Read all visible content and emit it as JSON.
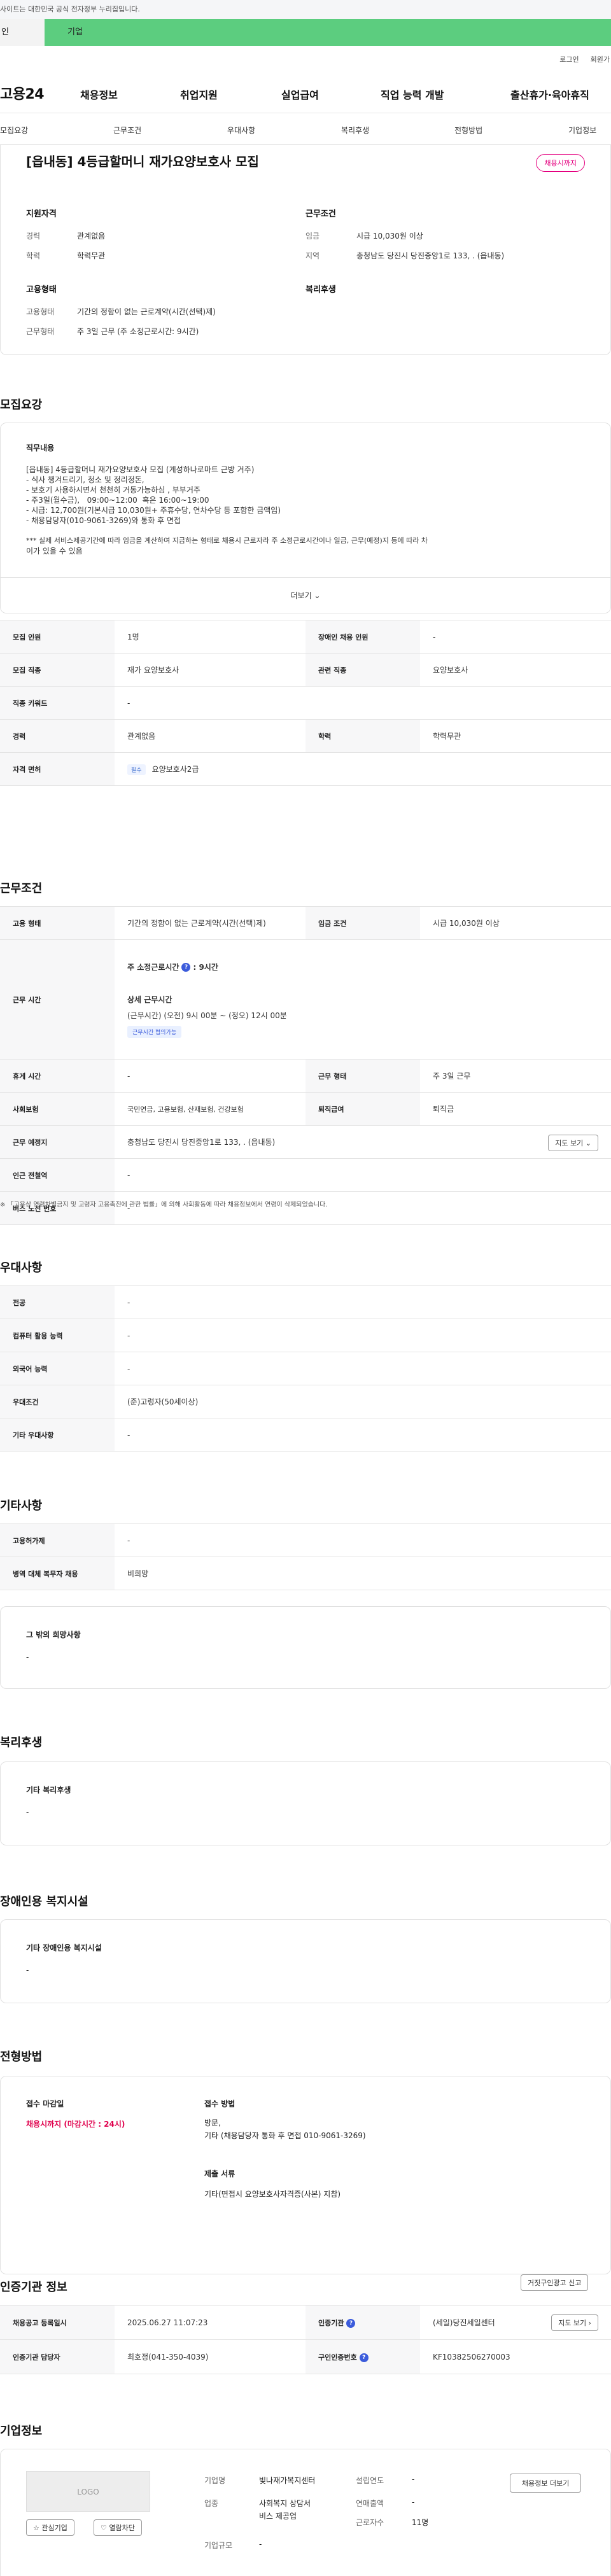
{
  "gov_banner": "사이트는 대한민국 공식 전자정부 누리집입니다.",
  "tabs": [
    "인",
    "기업"
  ],
  "utility": {
    "login": "로그인",
    "join": "회원가"
  },
  "logo": "고용24",
  "gnb": [
    "채용정보",
    "취업지원",
    "실업급여",
    "직업 능력 개발",
    "출산휴가·육아휴직"
  ],
  "lnb": [
    "모집요강",
    "근무조건",
    "우대사항",
    "복리후생",
    "전형방법",
    "기업정보"
  ],
  "header": {
    "title": "[읍내동] 4등급할머니 재가요양보호사 모집",
    "status_badge": "채용시까지",
    "qualification_title": "지원자격",
    "career_label": "경력",
    "career_value": "관계없음",
    "education_label": "학력",
    "education_value": "학력무관",
    "conditions_title": "근무조건",
    "wage_label": "임금",
    "wage_value": "시급 10,030원 이상",
    "region_label": "지역",
    "region_value": "충청남도 당진시 당진중앙1로 133, . (읍내동)",
    "employment_title": "고용형태",
    "emp_type_label": "고용형태",
    "emp_type_value": "기간의 정함이 없는 근로계약(시간(선택)제)",
    "work_type_label": "근무형태",
    "work_type_value": "주 3일 근무 (주 소정근로시간: 9시간)",
    "welfare_title": "복리후생"
  },
  "recruit": {
    "section_title": "모집요강",
    "job_title": "직무내용",
    "lines": [
      "[읍내동] 4등급할머니 재가요양보호사 모집 (계성하나로마트 근방 거주)",
      "- 식사 챙겨드리기, 청소 및 정리정돈,",
      "- 보호기 사용하시면서 천천히 거동가능하심 , 부부거주",
      "- 주3일(월수금),   09:00~12:00  혹은 16:00~19:00",
      "- 시급: 12,700원(기본시급 10,030원+ 주휴수당, 연차수당 등 포함한 금액임)",
      "- 채용담당자(010-9061-3269)와 통화 후 면접",
      "",
      "*** 실제 서비스제공기간에 따라 임금을 계산하여 지급하는 형태로 채용시 근로자라 주 소정근로시간이나 일급, 근무(예정)지 등에 따라 차",
      "이가 있을 수 있음"
    ],
    "more_label": "더보기 ⌄",
    "table": {
      "headcount_label": "모집 인원",
      "headcount_value": "1명",
      "disabled_label": "장애인 채용 인원",
      "disabled_value": "-",
      "job_label": "모집 직종",
      "job_value": "재가 요양보호사",
      "related_label": "관련 직종",
      "related_value": "요양보호사",
      "keyword_label": "직종 키워드",
      "keyword_value": "-",
      "career_label": "경력",
      "career_value": "관계없음",
      "edu_label": "학력",
      "edu_value": "학력무관",
      "license_label": "자격 면허",
      "license_badge": "필수",
      "license_value": "요양보호사2급"
    }
  },
  "work": {
    "section_title": "근무조건",
    "emp_label": "고용 형태",
    "emp_value": "기간의 정함이 없는 근로계약(시간(선택)제)",
    "wage_label": "임금 조건",
    "wage_value": "시급 10,030원 이상",
    "hours_label": "근무 시간",
    "weekly_hours": "주 소정근로시간",
    "weekly_hours_value": ": 9시간",
    "detail_title": "상세 근무시간",
    "detail_value": "(근무시간) (오전) 9시 00분 ~ (정오) 12시 00분",
    "consult_badge": "근무시간 협의가능",
    "rest_label": "휴게 시간",
    "rest_value": "-",
    "work_form_label": "근무 형태",
    "work_form_value": "주 3일 근무",
    "insurance_label": "사회보험",
    "insurance_value": "국민연금, 고용보험, 산재보험, 건강보험",
    "severance_label": "퇴직급여",
    "severance_value": "퇴직금",
    "location_label": "근무 예정지",
    "location_value": "충청남도 당진시 당진중앙1로 133, . (읍내동)",
    "map_button": "지도 보기 ⌄",
    "subway_label": "인근 전철역",
    "subway_value": "-",
    "bus_label": "버스 노선 번호",
    "bus_value": "-",
    "note": "※ 「고용상 연령차별금지 및 고령자 고용촉진에 관한 법률」에 의해 사회활동에 따라 채용정보에서 연령이 삭제되었습니다."
  },
  "preference": {
    "section_title": "우대사항",
    "major_label": "전공",
    "major_value": "-",
    "computer_label": "컴퓨터 활용 능력",
    "computer_value": "-",
    "language_label": "외국어 능력",
    "language_value": "-",
    "condition_label": "우대조건",
    "condition_value": "(준)고령자(50세이상)",
    "etc_label": "기타 우대사항",
    "etc_value": "-"
  },
  "other": {
    "section_title": "기타사항",
    "hire_label": "고용허가제",
    "hire_value": "-",
    "military_label": "병역 대체 복무자 채용",
    "military_value": "비희망",
    "hope_title": "그 밖의 희망사항",
    "hope_value": "-"
  },
  "welfare": {
    "section_title": "복리후생",
    "sub": "기타 복리후생",
    "value": "-"
  },
  "disabled_facility": {
    "section_title": "장애인용 복지시설",
    "sub": "기타 장애인용 복지시설",
    "value": "-"
  },
  "screening": {
    "section_title": "전형방법",
    "deadline_title": "접수 마감일",
    "deadline_value": "채용시까지 (마감시간 : 24시)",
    "method_title": "접수 방법",
    "method_value1": "방문,",
    "method_value2": "기타 (채용담당자 통화 후 면접 010-9061-3269)",
    "documents_title": "제출 서류",
    "documents_value": "기타(면접시 요양보호사자격증(사본) 지참)"
  },
  "agency": {
    "section_title": "인증기관 정보",
    "report_button": "거짓구인광고 신고",
    "posted_label": "채용공고 등록일시",
    "posted_value": "2025.06.27 11:07:23",
    "agency_label": "인증기관",
    "agency_value": "(세일)당진세일센터",
    "map_button": "지도 보기 ›",
    "manager_label": "인증기관 담당자",
    "manager_value": "최호정(041-350-4039)",
    "job_no_label": "구인인증번호",
    "job_no_value": "KF10382506270003"
  },
  "company": {
    "section_title": "기업정보",
    "logo_placeholder": "LOGO",
    "interest_button": "☆ 관심기업",
    "block_button": "♡ 열람차단",
    "name_label": "기업명",
    "name_value": "빛나재가복지센터",
    "founded_label": "설립연도",
    "founded_value": "-",
    "industry_label": "업종",
    "industry_value1": "사회복지 상담서",
    "industry_value2": "비스 제공업",
    "revenue_label": "연매출액",
    "revenue_value": "-",
    "employees_label": "근로자수",
    "employees_value": "11명",
    "size_label": "기업규모",
    "size_value": "-",
    "jobs_button": "채용정보 더보기"
  }
}
